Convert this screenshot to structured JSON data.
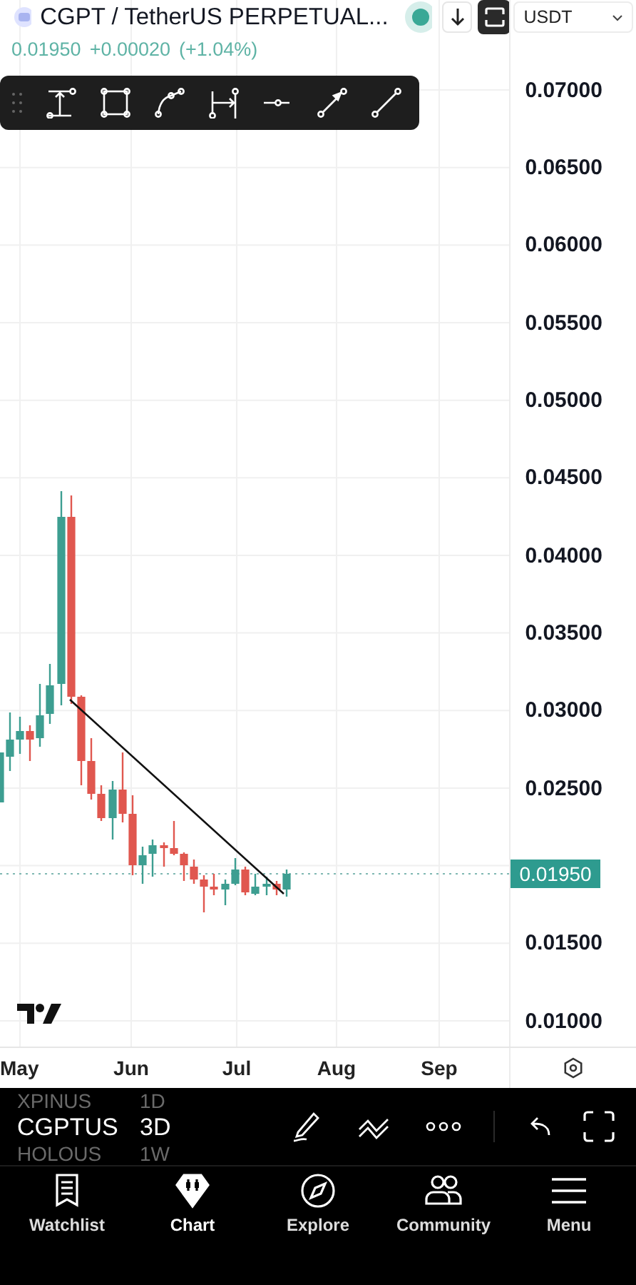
{
  "header": {
    "title": "CGPT / TetherUS PERPETUAL...",
    "price": "0.01950",
    "change": "+0.00020",
    "change_pct": "(+1.04%)",
    "currency": "USDT"
  },
  "price_axis": [
    {
      "text": "0.07000",
      "kind": "tick"
    },
    {
      "text": "0.06500",
      "kind": "tick"
    },
    {
      "text": "0.06000",
      "kind": "tick"
    },
    {
      "text": "0.05500",
      "kind": "tick"
    },
    {
      "text": "0.05000",
      "kind": "tick"
    },
    {
      "text": "0.04500",
      "kind": "tick"
    },
    {
      "text": "0.04000",
      "kind": "tick"
    },
    {
      "text": "0.03500",
      "kind": "tick"
    },
    {
      "text": "0.03000",
      "kind": "tick"
    },
    {
      "text": "0.02500",
      "kind": "tick"
    },
    {
      "text": "0.01950",
      "kind": "current"
    },
    {
      "text": "0.01500",
      "kind": "tick"
    },
    {
      "text": "0.01000",
      "kind": "tick"
    }
  ],
  "time_axis": [
    "May",
    "Jun",
    "Jul",
    "Aug",
    "Sep"
  ],
  "symbol_picker": [
    {
      "symbol": "XPINUS",
      "interval": "1D",
      "selected": false
    },
    {
      "symbol": "CGPTUS",
      "interval": "3D",
      "selected": true
    },
    {
      "symbol": "HOLOUS",
      "interval": "1W",
      "selected": false
    }
  ],
  "nav": [
    {
      "label": "Watchlist",
      "kind": "watchlist",
      "selected": false
    },
    {
      "label": "Chart",
      "kind": "chart",
      "selected": true
    },
    {
      "label": "Explore",
      "kind": "explore",
      "selected": false
    },
    {
      "label": "Community",
      "kind": "community",
      "selected": false
    },
    {
      "label": "Menu",
      "kind": "menu",
      "selected": false
    }
  ]
}
